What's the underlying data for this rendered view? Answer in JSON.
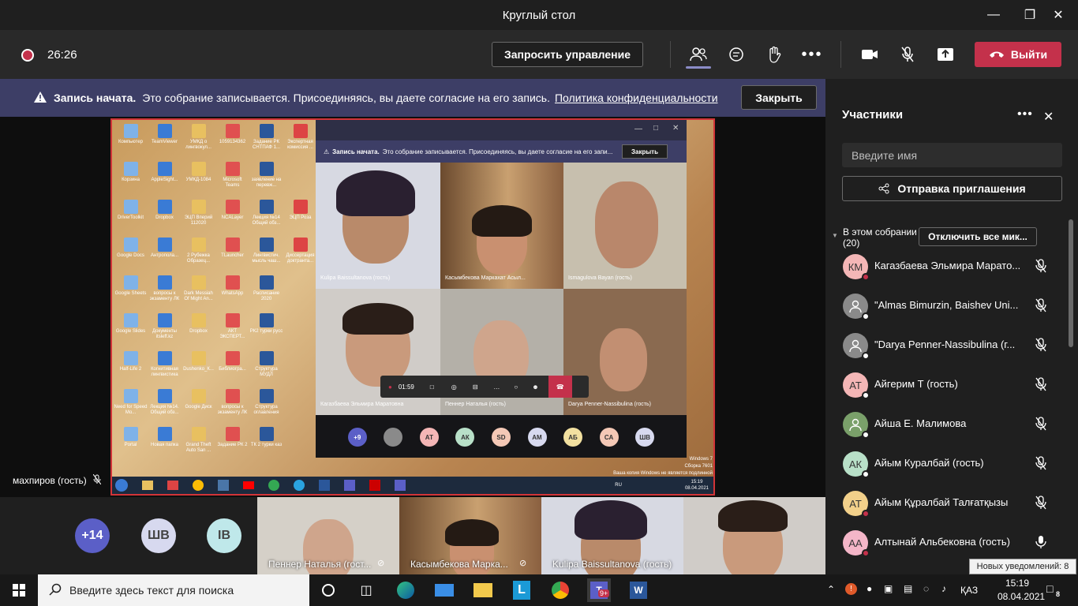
{
  "window": {
    "title": "Круглый стол"
  },
  "meeting": {
    "timer": "26:26",
    "request_control": "Запросить управление",
    "leave": "Выйти"
  },
  "banner": {
    "bold": "Запись начата.",
    "text": "Это собрание записывается. Присоединяясь, вы даете согласие на его запись.",
    "link": "Политика конфиденциальности",
    "close": "Закрыть"
  },
  "share": {
    "speaker_name": "махпиров (гость)",
    "desktop_icons": [
      "Компьютер",
      "TeamViewer",
      "УМКД о лингвокул...",
      "1059134362",
      "Задание РК СНТПАФ 1...",
      "Экспертная комиссия ...",
      "Корзина",
      "AppleSight...",
      "УМКД-1084",
      "Microsoft Teams",
      "заявление на перевж...",
      "",
      "DriverToolkit",
      "Dropbox",
      "ЭЦП Вперий 112020",
      "NCALayer",
      "Лекция №14 Общий обз...",
      "ЭЦП Роза",
      "Google Docs",
      "Антропола...",
      "2 Рубежка Образец...",
      "TLauncher",
      "Лингвистич. мысль чаш...",
      "Диссертация доктранта...",
      "Google Sheets",
      "вопросы к экзаменту ЛК",
      "Dark Messiah Of Might An...",
      "WhatsApp",
      "Расписание 2020",
      "",
      "Google Slides",
      "Документы itsleff.kz",
      "Dropbox",
      "АКТ ЭКСПЕРТ...",
      "РК2 турки русс",
      "",
      "Half-Life 2",
      "Когнитивная лингвистика",
      "Dushenko_К...",
      "Библиогра...",
      "Структура МУДЛ",
      "",
      "Need for Speed Mo...",
      "Лекция №14. Общий обз...",
      "Google Диск",
      "вопросы к экзаменту ЛК",
      "Структура оглавления",
      "",
      "Portal",
      "Новая папка",
      "Grand Theft Auto San ...",
      "Задание РК 2",
      "ТК 2 турки каз",
      ""
    ],
    "win_watermark": [
      "Windows 7",
      "Сборка 7601",
      "Ваша копия Windows не является подлинной"
    ],
    "win_tray": {
      "lang": "RU",
      "time": "15:19",
      "date": "08.04.2021"
    },
    "mini": {
      "banner_bold": "Запись начата.",
      "banner_text": "Это собрание записывается. Присоединяясь, вы даете согласие на его запи...",
      "close": "Закрыть",
      "timer": "01:59",
      "tiles": [
        "Kulipa Baissultanova (гость)",
        "Касымбекова Маркахат Асыл...",
        "Ismagulova Bayan (гость)",
        "Кагазбаева Эльмира Маратовна",
        "Пеннер Наталья (гость)",
        "Darya Penner-Nassibulina (гость)"
      ],
      "avatars": [
        "+9",
        "",
        "АТ",
        "АК",
        "SD",
        "AM",
        "АБ",
        "СА",
        "ШВ"
      ]
    }
  },
  "strip": {
    "avatars": [
      "+14",
      "ШВ",
      "IB"
    ],
    "tiles": [
      "Пеннер Наталья (гост...",
      "Касымбекова Марка...",
      "Kulipa Baissultanova (гость)",
      ""
    ]
  },
  "panel": {
    "title": "Участники",
    "search_placeholder": "Введите имя",
    "invite": "Отправка приглашения",
    "in_meeting": "В этом собрании (20)",
    "mute_all": "Отключить все мик...",
    "participants": [
      {
        "initials": "КМ",
        "name": "Кагазбаева Эльмира Марато...",
        "color": "#f4b6b6",
        "mic": "muted"
      },
      {
        "initials": "",
        "name": "\"Almas Bimurzin, Baishev Uni...",
        "color": "#8a8a8a",
        "mic": "muted"
      },
      {
        "initials": "",
        "name": "\"Darya Penner-Nassibulina (г...",
        "color": "#8a8a8a",
        "mic": "muted"
      },
      {
        "initials": "АТ",
        "name": "Айгерим Т (гость)",
        "color": "#f4b6b6",
        "mic": "muted"
      },
      {
        "initials": "",
        "name": "Айша Е. Малимова",
        "color": "#7aa06a",
        "mic": "muted"
      },
      {
        "initials": "АК",
        "name": "Айым Куралбай (гость)",
        "color": "#b8e0c8",
        "mic": "muted"
      },
      {
        "initials": "АТ",
        "name": "Айым Құралбай Талғатқызы",
        "color": "#f2d08a",
        "mic": "muted"
      },
      {
        "initials": "АА",
        "name": "Алтынай Альбековна (гость)",
        "color": "#f4b6c8",
        "mic": "on"
      }
    ]
  },
  "notification": "Новых уведомлений: 8",
  "taskbar": {
    "search_placeholder": "Введите здесь текст для поиска",
    "lang": "ҚАЗ",
    "time": "15:19",
    "date": "08.04.2021",
    "teams_badge": "9+",
    "action_badge": "8"
  }
}
